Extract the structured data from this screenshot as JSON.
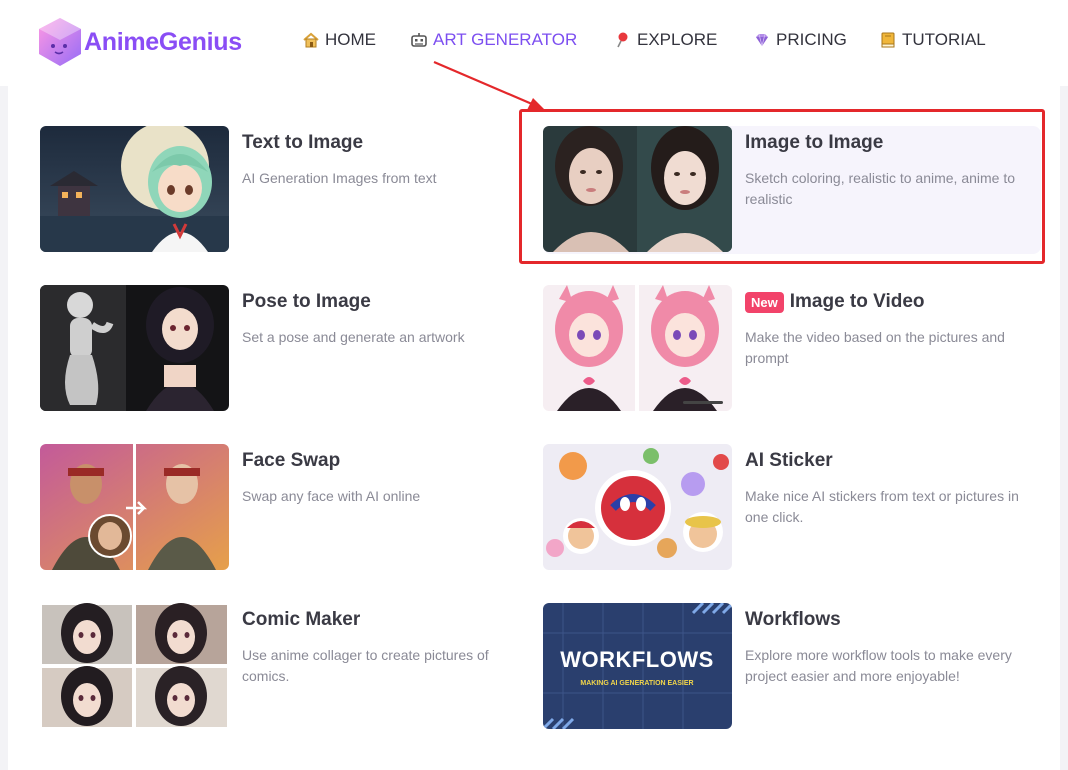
{
  "brand": {
    "name": "AnimeGenius"
  },
  "nav": [
    {
      "label": "HOME",
      "icon": "home-icon"
    },
    {
      "label": "ART GENERATOR",
      "icon": "robot-icon",
      "active": true
    },
    {
      "label": "EXPLORE",
      "icon": "pin-icon"
    },
    {
      "label": "PRICING",
      "icon": "diamond-icon"
    },
    {
      "label": "TUTORIAL",
      "icon": "book-icon"
    }
  ],
  "cards": [
    {
      "title": "Text to Image",
      "desc": "AI Generation Images from text"
    },
    {
      "title": "Image to Image",
      "desc": "Sketch coloring, realistic to anime, anime to realistic"
    },
    {
      "title": "Pose to Image",
      "desc": "Set a pose and generate an artwork"
    },
    {
      "title": "Image to Video",
      "desc": "Make the video based on the pictures and prompt",
      "badge": "New"
    },
    {
      "title": "Face Swap",
      "desc": "Swap any face with AI online"
    },
    {
      "title": "AI Sticker",
      "desc": "Make nice AI stickers from text or pictures in one click."
    },
    {
      "title": "Comic Maker",
      "desc": "Use anime collager to create pictures of comics."
    },
    {
      "title": "Workflows",
      "desc": "Explore more workflow tools to make every project easier and more enjoyable!"
    }
  ],
  "thumbnails": {
    "workflows_title": "WORKFLOWS",
    "workflows_sub": "MAKING AI GENERATION EASIER"
  },
  "colors": {
    "accent": "#7c4ef0",
    "highlight": "#e4282b",
    "badge": "#f2436a"
  }
}
